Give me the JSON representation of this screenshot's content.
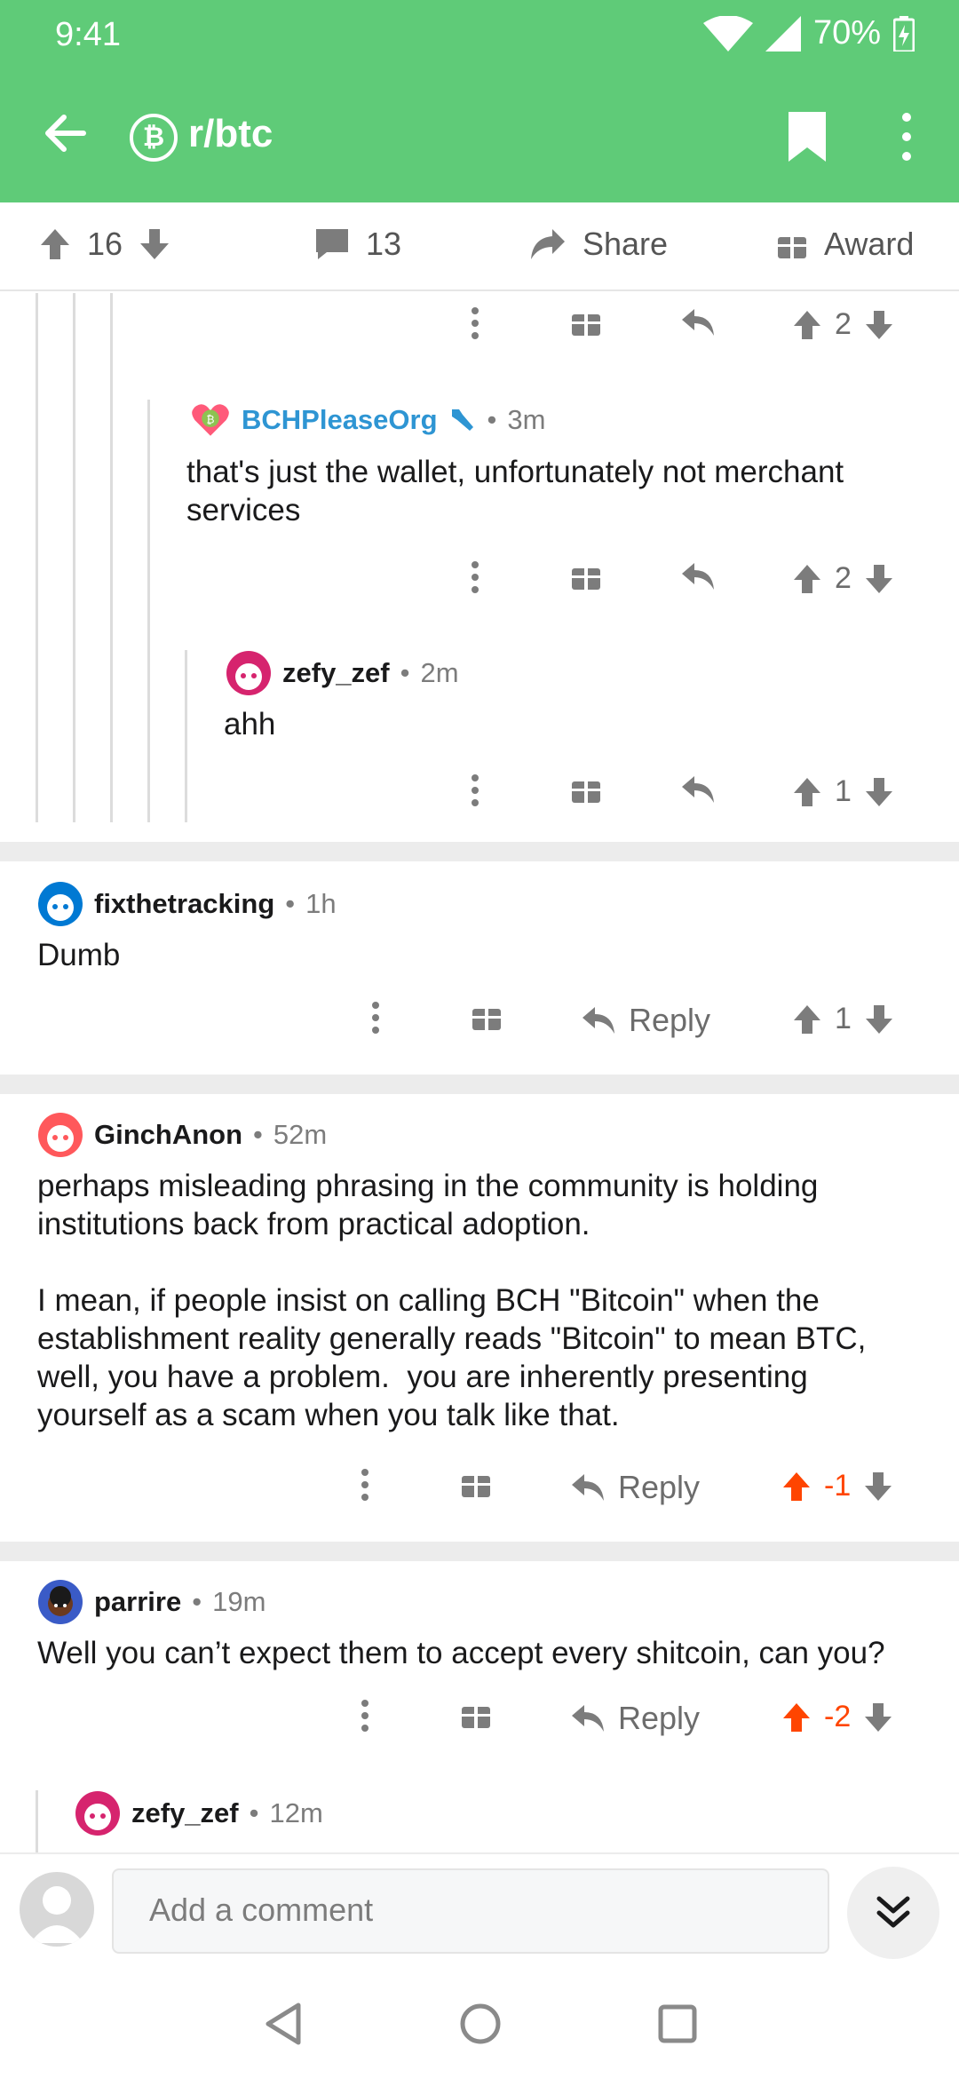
{
  "status_bar": {
    "time": "9:41",
    "battery": "70%"
  },
  "app_bar": {
    "subreddit": "r/btc",
    "sub_icon_glyph": "₿"
  },
  "post_actions": {
    "upvotes": "16",
    "comments": "13",
    "share_label": "Share",
    "award_label": "Award"
  },
  "top_comment_fragment": {
    "votes": "2"
  },
  "comments": [
    {
      "username": "BCHPleaseOrg",
      "time": "3m",
      "body": "that's just the wallet, unfortunately not merchant\nservices",
      "votes": "2"
    },
    {
      "username": "zefy_zef",
      "time": "2m",
      "body": "ahh",
      "votes": "1"
    },
    {
      "username": "fixthetracking",
      "time": "1h",
      "body": "Dumb",
      "reply_label": "Reply",
      "votes": "1"
    },
    {
      "username": "GinchAnon",
      "time": "52m",
      "body": "perhaps misleading phrasing in the community is holding\ninstitutions back from practical adoption.\n\nI mean, if people insist on calling BCH \"Bitcoin\" when the\nestablishment reality generally reads \"Bitcoin\" to mean BTC,\nwell, you have a problem.  you are inherently presenting\nyourself as a scam when you talk like that.",
      "reply_label": "Reply",
      "votes": "-1"
    },
    {
      "username": "parrire",
      "time": "19m",
      "body": "Well you can’t expect them to accept every shitcoin, can you?",
      "reply_label": "Reply",
      "votes": "-2"
    },
    {
      "username": "zefy_zef",
      "time": "12m"
    }
  ],
  "meta_separator": "•",
  "bottom_bar": {
    "placeholder": "Add a comment"
  },
  "colors": {
    "brand_green": "#5fcb78",
    "upvote_orange": "#ff4500",
    "username_blue": "#2e95d3"
  },
  "icons": [
    "back-arrow-icon",
    "bitcoin-icon",
    "bookmark-icon",
    "kebab-icon",
    "upvote-icon",
    "downvote-icon",
    "comment-icon",
    "share-icon",
    "gift-icon",
    "reply-icon",
    "double-chevron-down-icon"
  ]
}
